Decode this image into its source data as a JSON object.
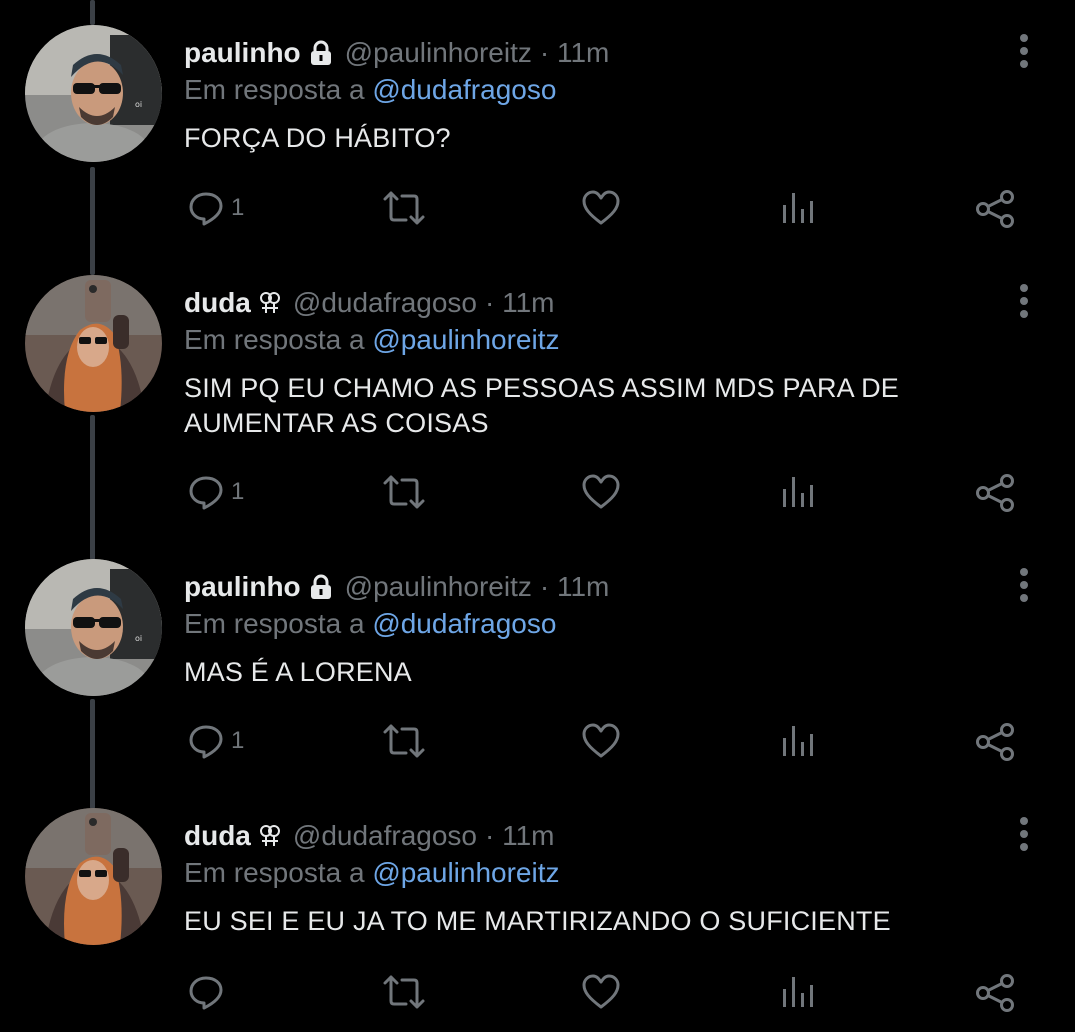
{
  "tweets": [
    {
      "name": "paulinho",
      "badge": "lock",
      "handle": "@paulinhoreitz",
      "time": "· 11m",
      "reply_prefix": "Em resposta a",
      "reply_to": "@dudafragoso",
      "text": "FORÇA DO HÁBITO?",
      "reply_count": "1",
      "avatar": "man-sunglasses"
    },
    {
      "name": "duda",
      "badge": "venus-symbol",
      "handle": "@dudafragoso",
      "time": "· 11m",
      "reply_prefix": "Em resposta a",
      "reply_to": "@paulinhoreitz",
      "text": "SIM PQ EU CHAMO AS PESSOAS ASSIM MDS PARA DE AUMENTAR AS COISAS",
      "reply_count": "1",
      "avatar": "woman-mirror-selfie"
    },
    {
      "name": "paulinho",
      "badge": "lock",
      "handle": "@paulinhoreitz",
      "time": "· 11m",
      "reply_prefix": "Em resposta a",
      "reply_to": "@dudafragoso",
      "text": "MAS É A LORENA",
      "reply_count": "1",
      "avatar": "man-sunglasses"
    },
    {
      "name": "duda",
      "badge": "venus-symbol",
      "handle": "@dudafragoso",
      "time": "· 11m",
      "reply_prefix": "Em resposta a",
      "reply_to": "@paulinhoreitz",
      "text": "EU SEI E EU JA TO ME MARTIRIZANDO O SUFICIENTE",
      "reply_count": "",
      "avatar": "woman-mirror-selfie"
    }
  ],
  "icons": {
    "reply": "reply-icon",
    "retweet": "retweet-icon",
    "like": "heart-icon",
    "views": "views-icon",
    "share": "share-icon",
    "more": "more-vertical-icon"
  },
  "colors": {
    "background": "#000000",
    "text": "#e7e9ea",
    "muted": "#71767b",
    "mention": "#6ea6e6",
    "thread_line": "#3b4046"
  }
}
